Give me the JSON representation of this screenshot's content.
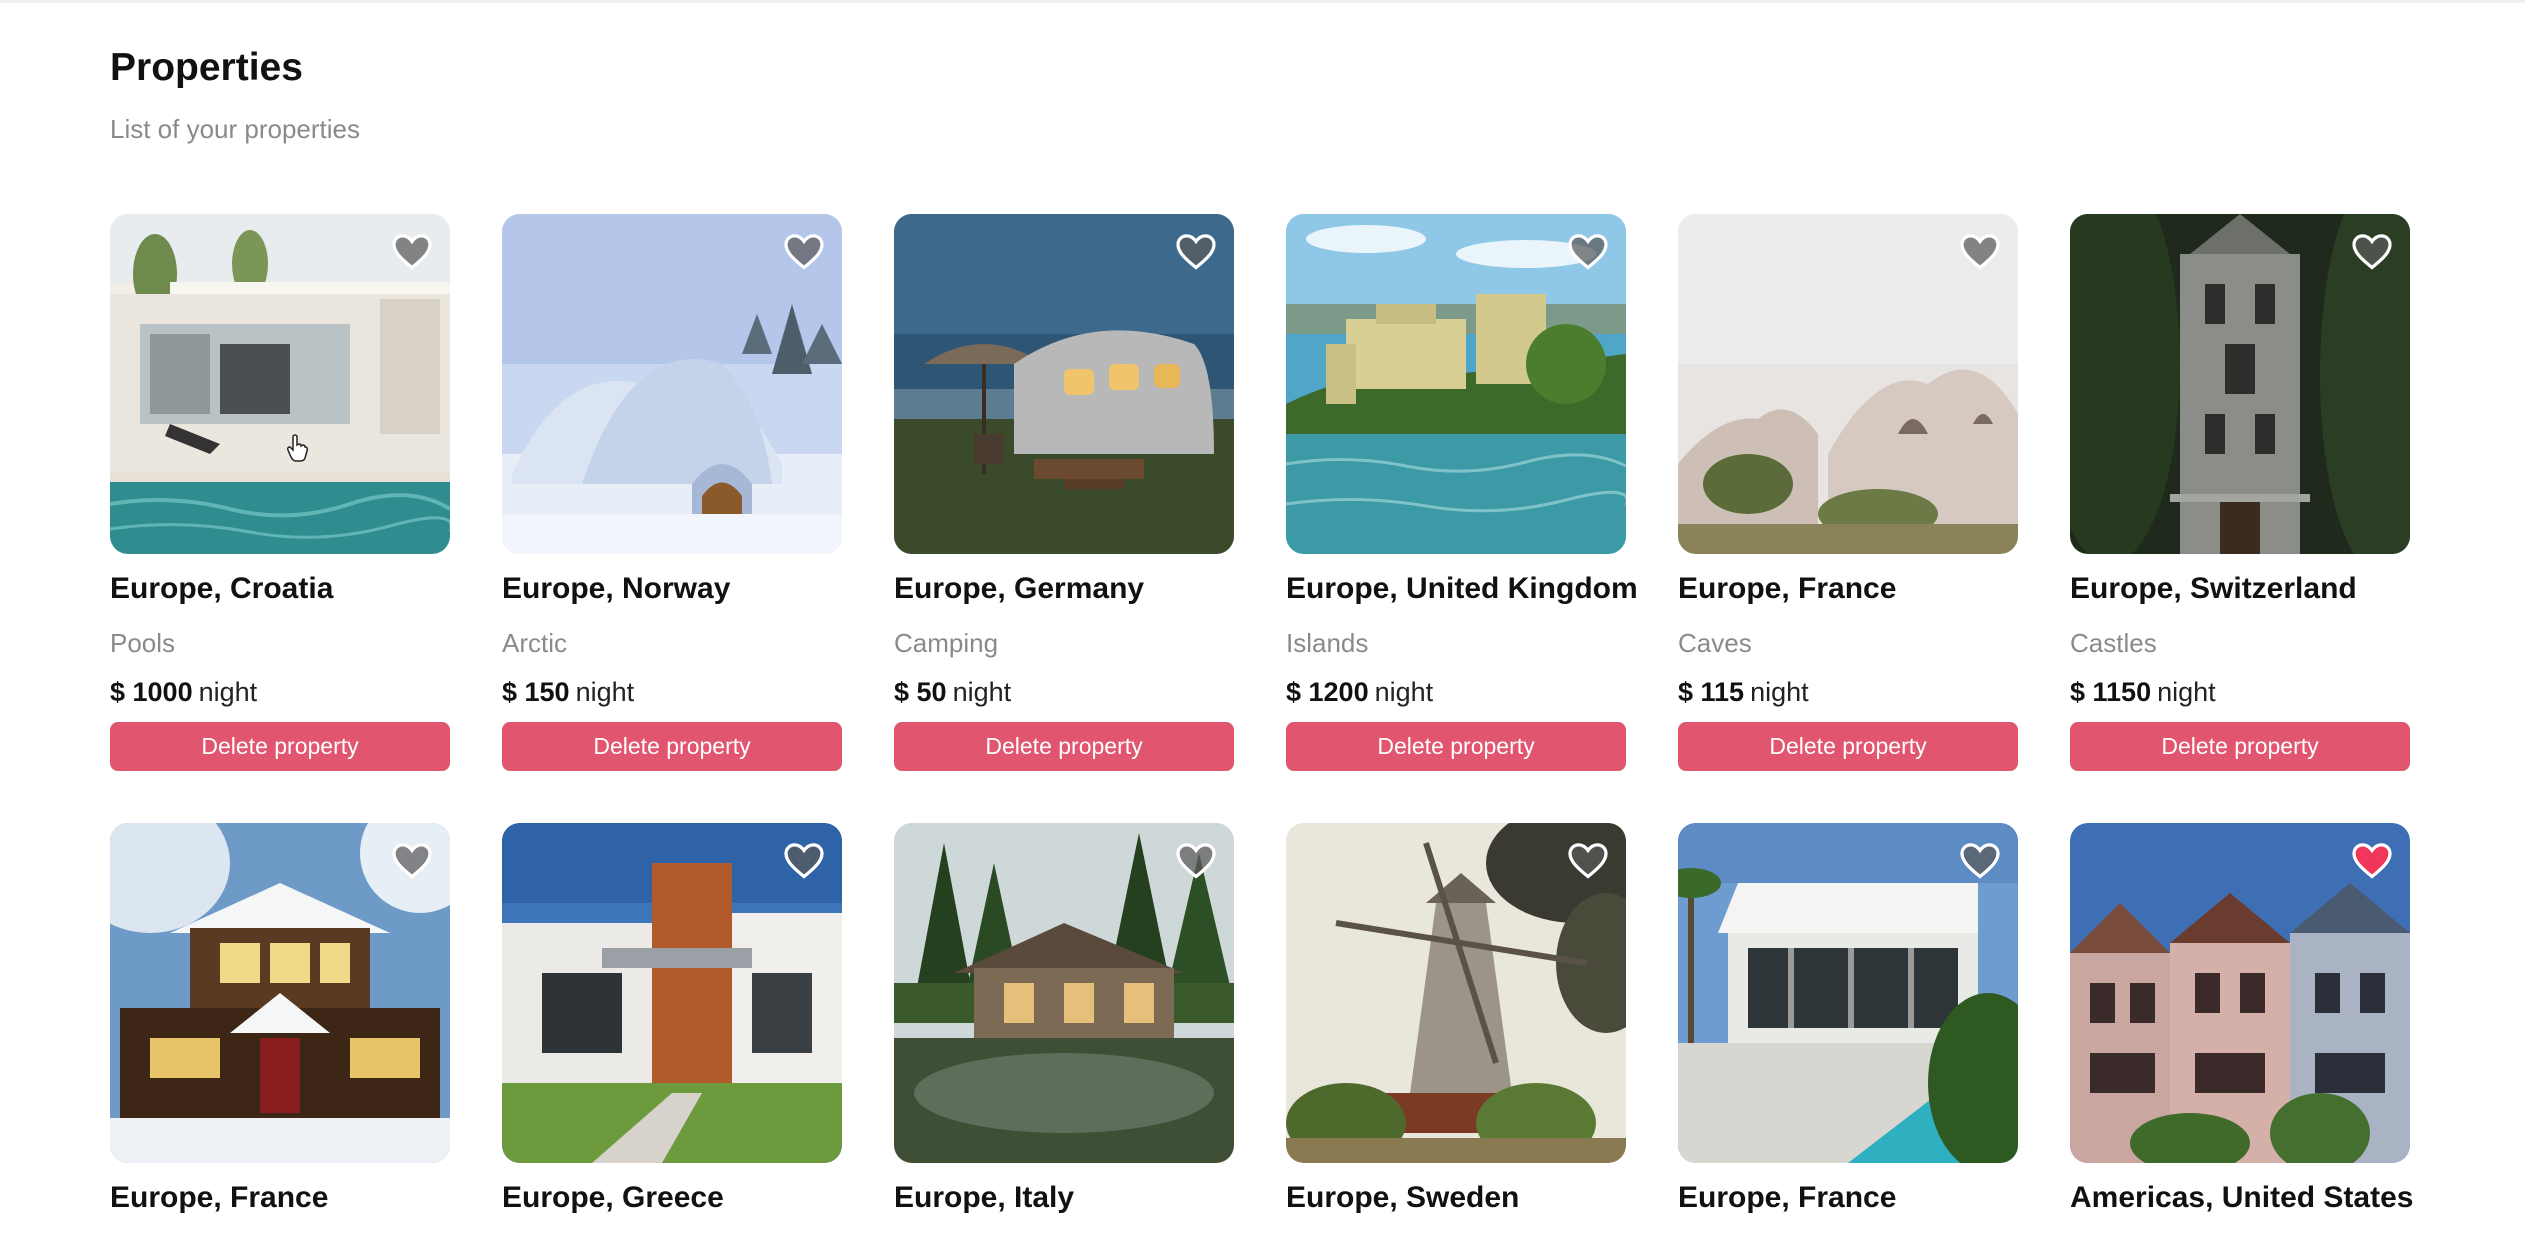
{
  "header": {
    "title": "Properties",
    "subtitle": "List of your properties"
  },
  "price_unit": "night",
  "delete_label": "Delete property",
  "colors": {
    "accent": "#e1556f",
    "favorite": "#f0365b",
    "muted_text": "#8a8a8a"
  },
  "properties": [
    {
      "location": "Europe, Croatia",
      "category": "Pools",
      "price": "$ 1000",
      "favorite": false,
      "image_icon": "modern-pool-house"
    },
    {
      "location": "Europe, Norway",
      "category": "Arctic",
      "price": "$ 150",
      "favorite": false,
      "image_icon": "ice-igloo"
    },
    {
      "location": "Europe, Germany",
      "category": "Camping",
      "price": "$ 50",
      "favorite": false,
      "image_icon": "vintage-trailer"
    },
    {
      "location": "Europe, United Kingdom",
      "category": "Islands",
      "price": "$ 1200",
      "favorite": false,
      "image_icon": "lakeside-villa"
    },
    {
      "location": "Europe, France",
      "category": "Caves",
      "price": "$ 115",
      "favorite": false,
      "image_icon": "rock-caves"
    },
    {
      "location": "Europe, Switzerland",
      "category": "Castles",
      "price": "$ 1150",
      "favorite": false,
      "image_icon": "stone-castle"
    },
    {
      "location": "Europe, France",
      "favorite": false,
      "image_icon": "snowy-cabin"
    },
    {
      "location": "Europe, Greece",
      "favorite": false,
      "image_icon": "modern-house"
    },
    {
      "location": "Europe, Italy",
      "favorite": false,
      "image_icon": "forest-cabin"
    },
    {
      "location": "Europe, Sweden",
      "favorite": false,
      "image_icon": "windmill"
    },
    {
      "location": "Europe, France",
      "favorite": false,
      "image_icon": "white-villa-pool"
    },
    {
      "location": "Americas, United States",
      "favorite": true,
      "image_icon": "victorian-houses"
    }
  ]
}
